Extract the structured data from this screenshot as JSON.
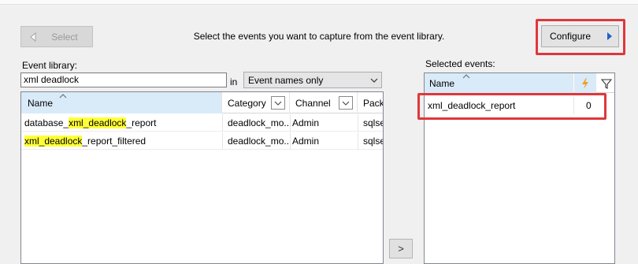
{
  "toolbar": {
    "select_label": "Select",
    "instruction": "Select the events you want to capture from the event library.",
    "configure_label": "Configure"
  },
  "library": {
    "label": "Event library:",
    "search_value": "xml deadlock",
    "in_label": "in",
    "filter_value": "Event names only",
    "columns": [
      "Name",
      "Category",
      "Channel",
      "Pack"
    ],
    "rows": [
      {
        "name_pre": "database_",
        "name_hl": "xml_deadlock",
        "name_post": "_report",
        "category": "deadlock_mo...",
        "channel": "Admin",
        "package": "sqlse"
      },
      {
        "name_pre": "",
        "name_hl": "xml_deadlock",
        "name_post": "_report_filtered",
        "category": "deadlock_mo...",
        "channel": "Admin",
        "package": "sqlse"
      }
    ]
  },
  "add_button_label": ">",
  "selected": {
    "label": "Selected events:",
    "column_name": "Name",
    "rows": [
      {
        "name": "xml_deadlock_report",
        "count": "0"
      }
    ]
  },
  "colors": {
    "highlight": "#ffff38",
    "callout_red": "#e0373b",
    "header_blue": "#d9ebf9",
    "accent_blue": "#1e64c8",
    "bolt_orange": "#f0a020"
  },
  "icons": {
    "select_arrow": "left-triangle-icon",
    "configure_arrow": "right-triangle-icon",
    "dropdown": "chevron-down-icon",
    "sort": "sort-up-icon",
    "column_filter": "chevron-down-icon",
    "actions": "lightning-bolt-icon",
    "predicate": "funnel-icon"
  }
}
